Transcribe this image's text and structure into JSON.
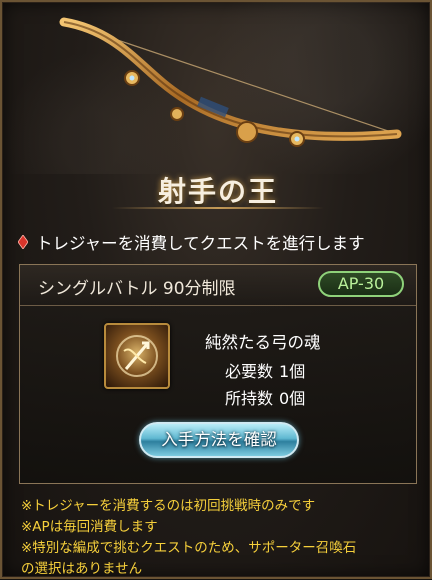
{
  "dialog": {
    "title": "射手の王",
    "notice": "トレジャーを消費してクエストを進行します",
    "panel": {
      "battle_label": "シングルバトル 90分制限",
      "ap_badge": "AP-30",
      "item_name": "純然たる弓の魂",
      "required_label": "必要数",
      "required_value": "1個",
      "owned_label": "所持数",
      "owned_value": "0個",
      "howto_button": "入手方法を確認"
    },
    "notes": [
      "※トレジャーを消費するのは初回挑戦時のみです",
      "※APは毎回消費します",
      "※特別な編成で挑むクエストのため、サポーター召喚石",
      "の選択はありません"
    ]
  },
  "icons": {
    "notice_icon": "red-diamond-icon",
    "item_icon": "bow-soul-treasure-icon",
    "header_art": "golden-bow-icon"
  },
  "colors": {
    "notice_diamond": "#d8342b",
    "ap_badge": "#8fd27a",
    "button": "#5fb8d1",
    "notes_text": "#f5cf3b"
  }
}
